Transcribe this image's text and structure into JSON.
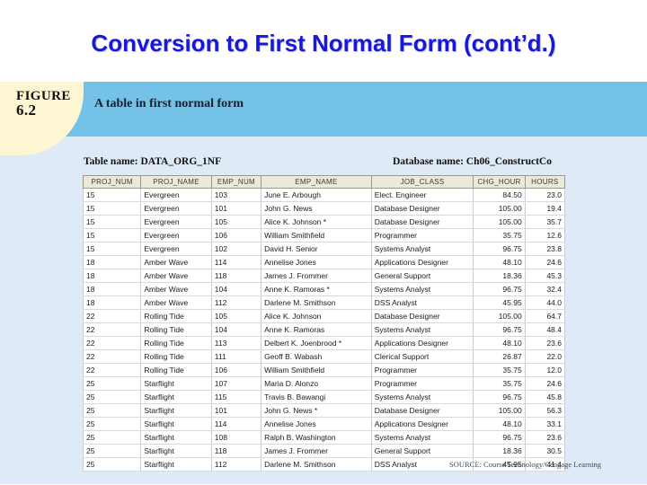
{
  "slide": {
    "title": "Conversion to First Normal Form (cont’d.)",
    "title_color": "#1818d8"
  },
  "figure": {
    "badge_label": "FIGURE",
    "badge_number": "6.2",
    "caption": "A table in first normal form",
    "header_color": "#74c2e8",
    "badge_color": "#fdf6d2",
    "panel_color": "#dfeaf7",
    "source_credit": "SOURCE: Course Technology/Cengage Learning"
  },
  "table_meta": {
    "table_name_label": "Table name: DATA_ORG_1NF",
    "database_name_label": "Database name: Ch06_ConstructCo"
  },
  "chart_data": {
    "type": "table",
    "title": "A table in first normal form",
    "columns": [
      "PROJ_NUM",
      "PROJ_NAME",
      "EMP_NUM",
      "EMP_NAME",
      "JOB_CLASS",
      "CHG_HOUR",
      "HOURS"
    ],
    "column_align": [
      "left",
      "left",
      "left",
      "left",
      "left",
      "right",
      "right"
    ],
    "rows": [
      [
        "15",
        "Evergreen",
        "103",
        "June E. Arbough",
        "Elect. Engineer",
        "84.50",
        "23.0"
      ],
      [
        "15",
        "Evergreen",
        "101",
        "John G. News",
        "Database Designer",
        "105.00",
        "19.4"
      ],
      [
        "15",
        "Evergreen",
        "105",
        "Alice K. Johnson *",
        "Database Designer",
        "105.00",
        "35.7"
      ],
      [
        "15",
        "Evergreen",
        "106",
        "William Smithfield",
        "Programmer",
        "35.75",
        "12.6"
      ],
      [
        "15",
        "Evergreen",
        "102",
        "David H. Senior",
        "Systems Analyst",
        "96.75",
        "23.8"
      ],
      [
        "18",
        "Amber Wave",
        "114",
        "Annelise Jones",
        "Applications Designer",
        "48.10",
        "24.6"
      ],
      [
        "18",
        "Amber Wave",
        "118",
        "James J. Frommer",
        "General Support",
        "18.36",
        "45.3"
      ],
      [
        "18",
        "Amber Wave",
        "104",
        "Anne K. Ramoras *",
        "Systems Analyst",
        "96.75",
        "32.4"
      ],
      [
        "18",
        "Amber Wave",
        "112",
        "Darlene M. Smithson",
        "DSS Analyst",
        "45.95",
        "44.0"
      ],
      [
        "22",
        "Rolling Tide",
        "105",
        "Alice K. Johnson",
        "Database Designer",
        "105.00",
        "64.7"
      ],
      [
        "22",
        "Rolling Tide",
        "104",
        "Anne K. Ramoras",
        "Systems Analyst",
        "96.75",
        "48.4"
      ],
      [
        "22",
        "Rolling Tide",
        "113",
        "Delbert K. Joenbrood *",
        "Applications Designer",
        "48.10",
        "23.6"
      ],
      [
        "22",
        "Rolling Tide",
        "111",
        "Geoff B. Wabash",
        "Clerical Support",
        "26.87",
        "22.0"
      ],
      [
        "22",
        "Rolling Tide",
        "106",
        "William Smithfield",
        "Programmer",
        "35.75",
        "12.0"
      ],
      [
        "25",
        "Starflight",
        "107",
        "Maria D. Alonzo",
        "Programmer",
        "35.75",
        "24.6"
      ],
      [
        "25",
        "Starflight",
        "115",
        "Travis B. Bawangi",
        "Systems Analyst",
        "96.75",
        "45.8"
      ],
      [
        "25",
        "Starflight",
        "101",
        "John G. News *",
        "Database Designer",
        "105.00",
        "56.3"
      ],
      [
        "25",
        "Starflight",
        "114",
        "Annelise Jones",
        "Applications Designer",
        "48.10",
        "33.1"
      ],
      [
        "25",
        "Starflight",
        "108",
        "Ralph B. Washington",
        "Systems Analyst",
        "96.75",
        "23.6"
      ],
      [
        "25",
        "Starflight",
        "118",
        "James J. Frommer",
        "General Support",
        "18.36",
        "30.5"
      ],
      [
        "25",
        "Starflight",
        "112",
        "Darlene M. Smithson",
        "DSS Analyst",
        "45.95",
        "41.4"
      ]
    ]
  }
}
